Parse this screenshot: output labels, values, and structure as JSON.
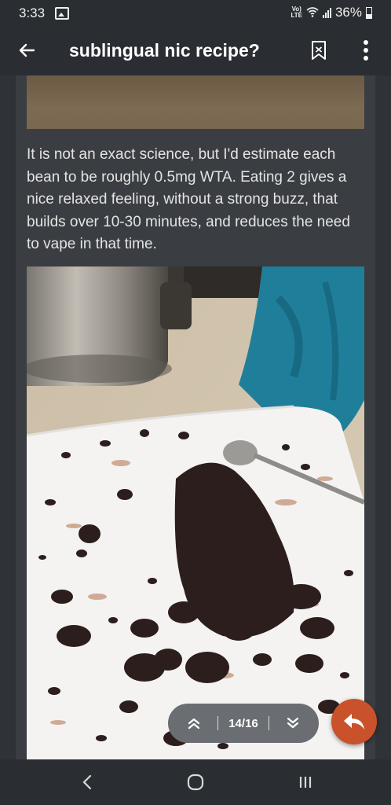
{
  "status_bar": {
    "time": "3:33",
    "volte_label": "Vo) LTE",
    "battery_percent": "36%"
  },
  "app_bar": {
    "title": "sublingual nic recipe?"
  },
  "post": {
    "body_text": "It is not an exact science, but I'd estimate each bean to be roughly 0.5mg WTA. Eating 2 gives a nice relaxed feeling, without a strong buzz, that builds over 10-30 minutes, and reduces the need to vape in that time."
  },
  "pager": {
    "position": "14/16"
  },
  "colors": {
    "accent": "#c9522a",
    "app_bar": "#2a2d31",
    "content_bg": "#3a3d42"
  },
  "icons": {
    "back": "arrow-left-icon",
    "bookmark": "bookmark-icon",
    "more": "more-vertical-icon",
    "prev": "double-chevron-up-icon",
    "next": "double-chevron-down-icon",
    "reply": "reply-icon"
  }
}
